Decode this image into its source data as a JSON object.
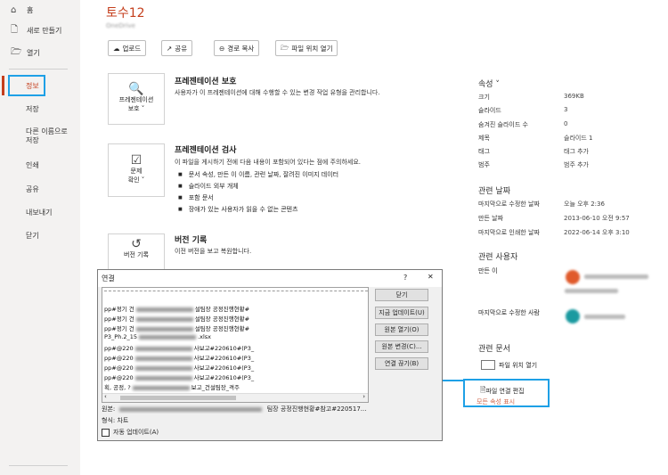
{
  "sidebar": {
    "items": [
      {
        "icon": "home-icon",
        "glyph": "⌂",
        "label": "홈"
      },
      {
        "icon": "new-doc-icon",
        "glyph": "🗋",
        "label": "새로 만들기"
      },
      {
        "icon": "open-folder-icon",
        "glyph": "🗁",
        "label": "열기"
      },
      {
        "label": "정보"
      },
      {
        "label": "저장"
      },
      {
        "label": "다른 이름으로\n저장"
      },
      {
        "label": "인쇄"
      },
      {
        "label": "공유"
      },
      {
        "label": "내보내기"
      },
      {
        "label": "닫기"
      }
    ]
  },
  "header": {
    "title": "토수12",
    "subtitle": "OneDrive"
  },
  "toolbar": {
    "upload": "업로드",
    "share": "공유",
    "copy_path": "경로 복사",
    "open_location": "파일 위치 열기"
  },
  "sections": {
    "protect": {
      "card_label": "프레젠테이션\n보호 ˅",
      "title": "프레젠테이션 보호",
      "desc": "사용자가 이 프레젠테이션에 대해 수행할 수 있는 변경 작업 유형을 관리합니다."
    },
    "inspect": {
      "card_label": "문제\n확인 ˅",
      "title": "프레젠테이션 검사",
      "desc": "이 파일을 게시하기 전에 다음 내용이 포함되어 있다는 점에 주의하세요.",
      "bullets": [
        "문서 속성, 만든 이 이름, 관련 날짜, 잘려진 이미지 데이터",
        "슬라이드 외부 개체",
        "포함 문서",
        "장애가 있는 사용자가 읽을 수 없는 콘텐츠"
      ]
    },
    "version": {
      "card_label": "버전 기록",
      "title": "버전 기록",
      "desc": "이전 버전을 보고 복원합니다."
    }
  },
  "properties": {
    "heading": "속성 ˅",
    "rows": [
      {
        "k": "크기",
        "v": "369KB"
      },
      {
        "k": "슬라이드",
        "v": "3"
      },
      {
        "k": "숨겨진 슬라이드 수",
        "v": "0"
      },
      {
        "k": "제목",
        "v": "슬라이드 1"
      },
      {
        "k": "태그",
        "v": "태그 추가"
      },
      {
        "k": "범주",
        "v": "범주 추가"
      }
    ],
    "dates_heading": "관련 날짜",
    "dates": [
      {
        "k": "마지막으로 수정한 날짜",
        "v": "오늘 오후 2:36"
      },
      {
        "k": "만든 날짜",
        "v": "2013-06-10 오전 9:57"
      },
      {
        "k": "마지막으로 인쇄한 날짜",
        "v": "2022-06-14 오후 3:10"
      }
    ],
    "people_heading": "관련 사용자",
    "author_label": "만든 이",
    "modified_by_label": "마지막으로 수정한 사람",
    "docs_heading": "관련 문서",
    "open_location": "파일 위치 열기",
    "edit_links": "파일 연결 편집",
    "show_all": "모든 속성 표시"
  },
  "dialog": {
    "title": "연결",
    "help": "?",
    "close": "✕",
    "rows": [
      {
        "a": "pp#정기 건",
        "b": "설팀장 공정진행현황#"
      },
      {
        "a": "pp#정기 건",
        "b": "설팀장 공정진행현황#"
      },
      {
        "a": "pp#정기 건",
        "b": "설팀장 공정진행현황#"
      },
      {
        "a": "P3_Ph.2_15",
        "b": ".xlsx"
      },
      {
        "a": "pp#@220",
        "b": "사보고#220610#(P3_"
      },
      {
        "a": "pp#@220",
        "b": "사보고#220610#(P3_"
      },
      {
        "a": "pp#@220",
        "b": "사보고#220610#(P3_"
      },
      {
        "a": "pp#@220",
        "b": "사보고#220610#(P3_"
      },
      {
        "a": "획, 공정, ?",
        "b": "보고_건설팀장_격주"
      }
    ],
    "buttons": [
      "닫기",
      "지금 업데이트(U)",
      "원본 열기(O)",
      "원본 변경(C)...",
      "연결 끊기(B)"
    ],
    "source_label": "원본:",
    "source_value": "팀장 공정진행현황#참고#220517...",
    "type_label": "형식:",
    "type_value": "차트",
    "auto_update": "자동 업데이트(A)"
  }
}
